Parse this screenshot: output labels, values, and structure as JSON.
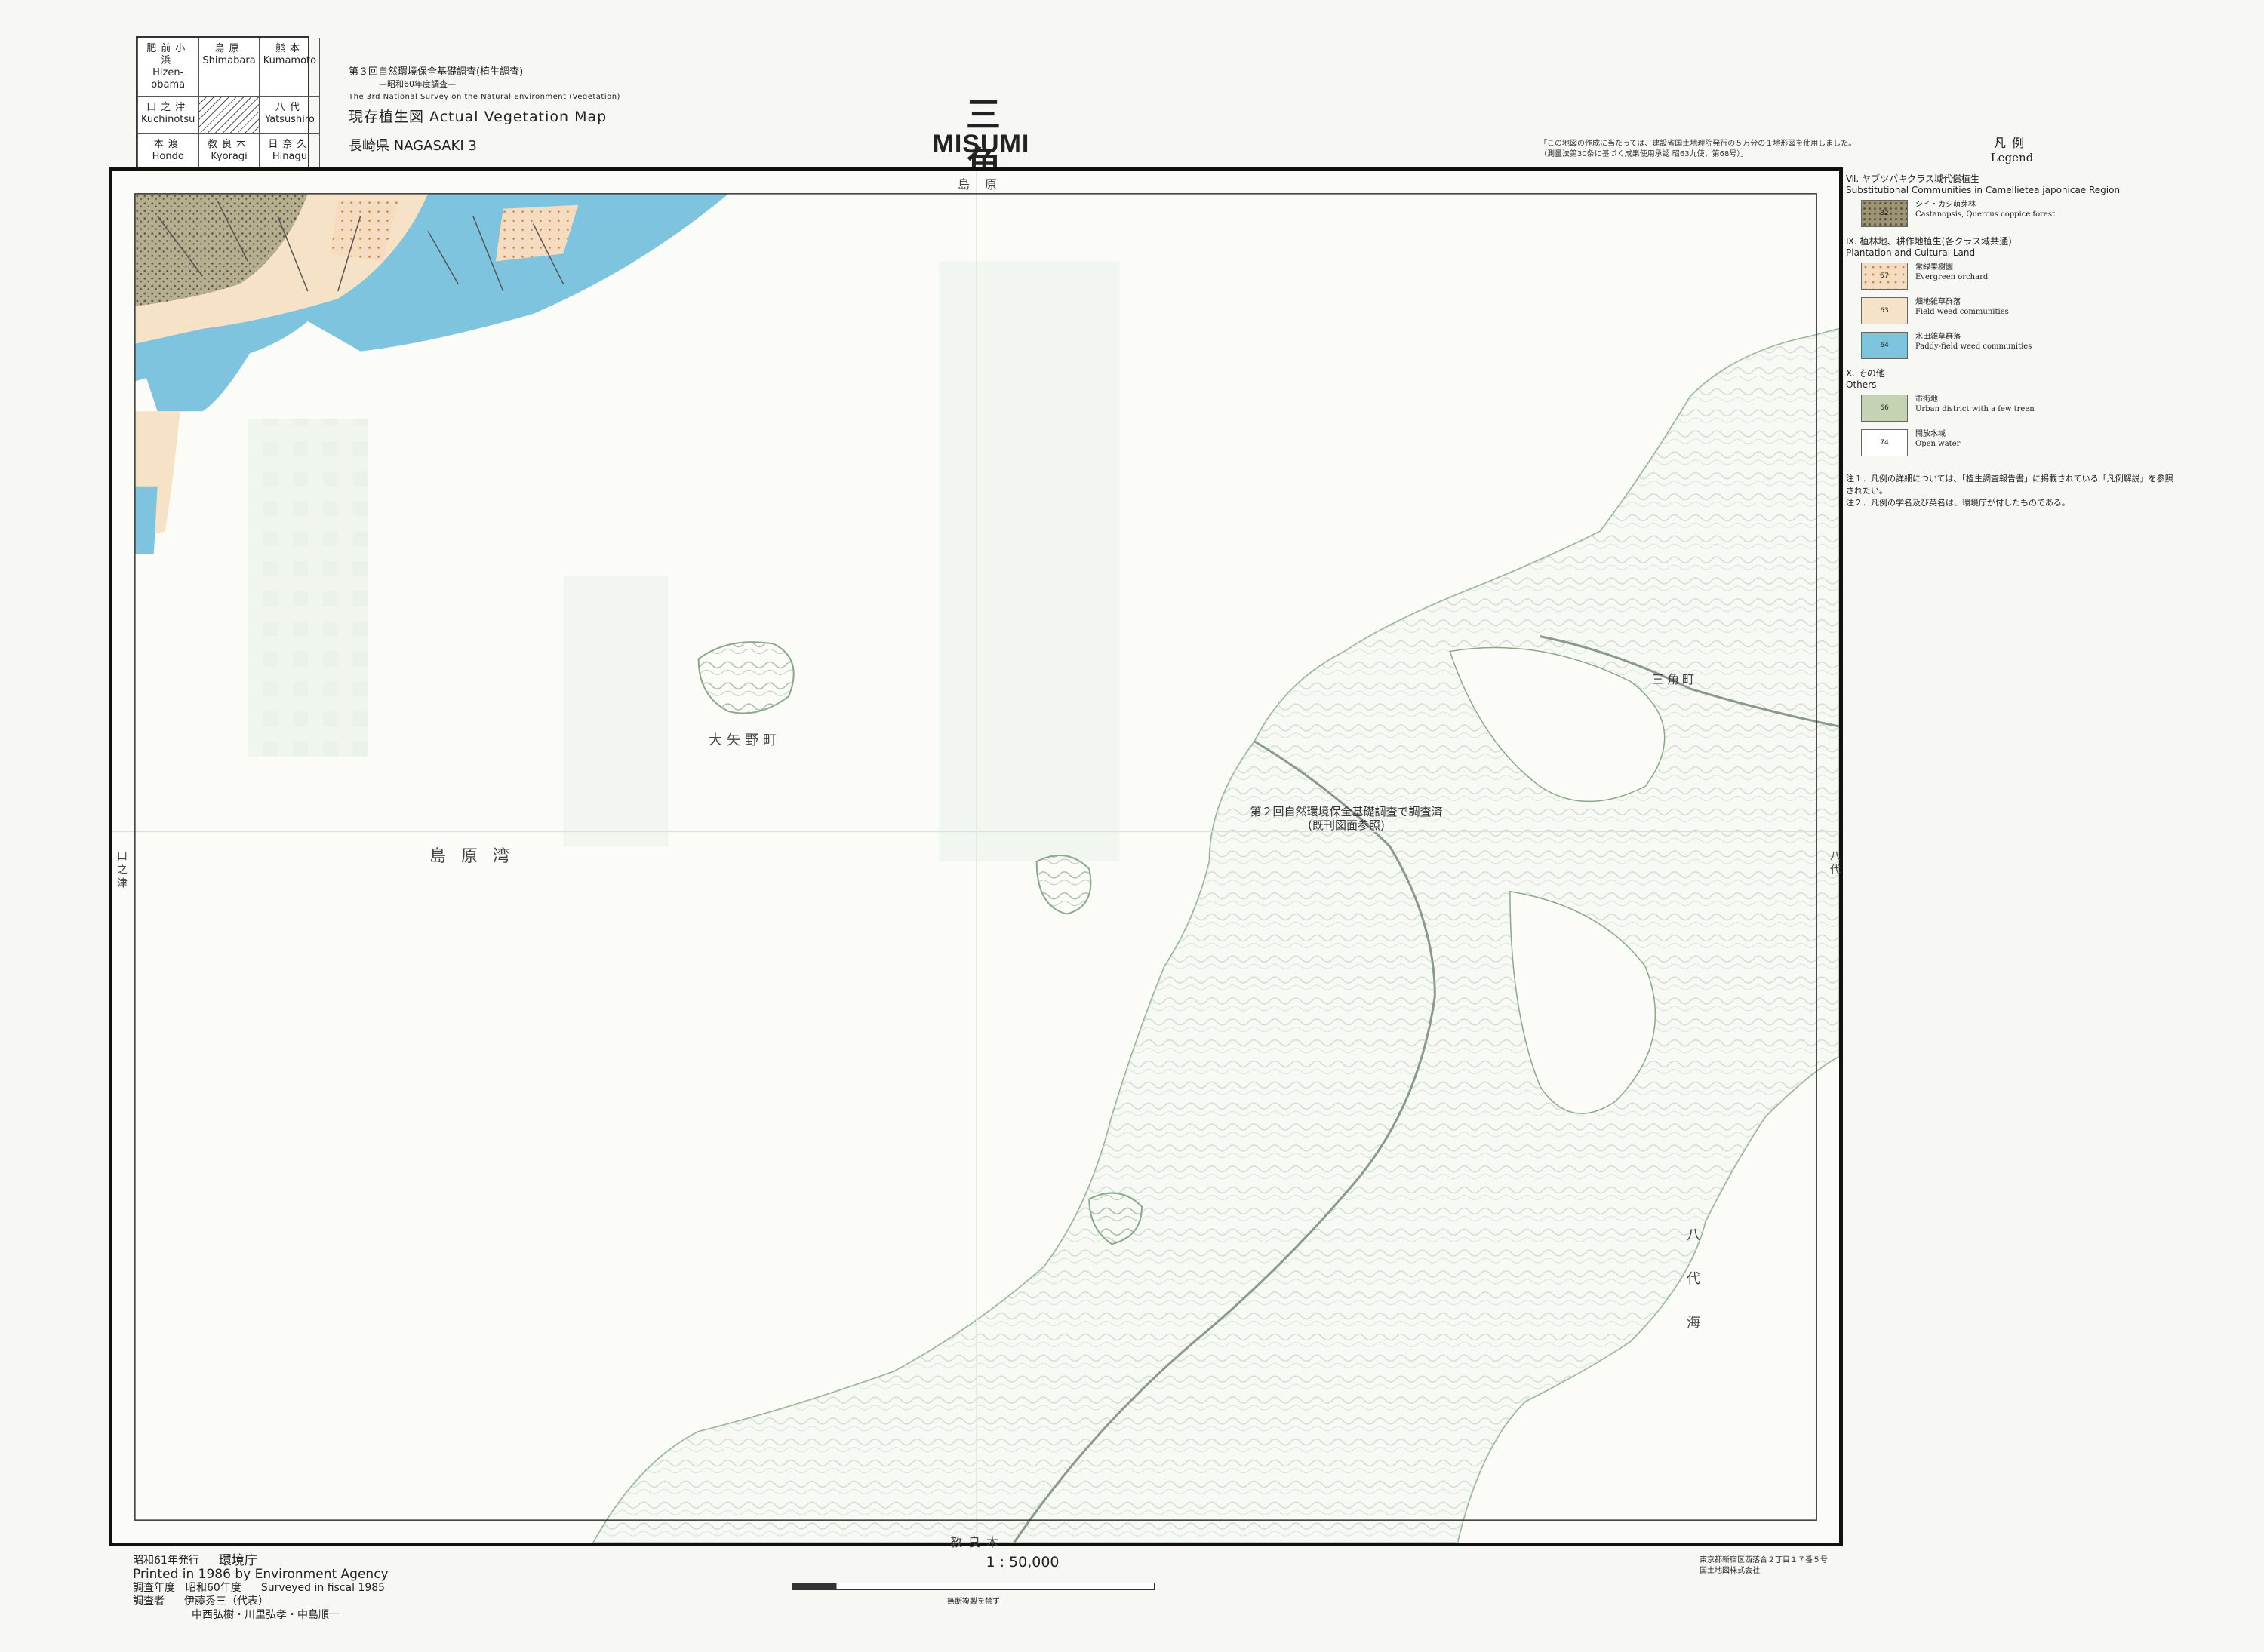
{
  "index_sheets": [
    {
      "jp": "肥前小浜",
      "en": "Hizen-obama"
    },
    {
      "jp": "島原",
      "en": "Shimabara"
    },
    {
      "jp": "熊本",
      "en": "Kumamoto"
    },
    {
      "jp": "口之津",
      "en": "Kuchinotsu"
    },
    {
      "jp": "",
      "en": ""
    },
    {
      "jp": "八代",
      "en": "Yatsushiro"
    },
    {
      "jp": "本渡",
      "en": "Hondo"
    },
    {
      "jp": "教良木",
      "en": "Kyoragi"
    },
    {
      "jp": "日奈久",
      "en": "Hinagu"
    }
  ],
  "survey": {
    "line1": "第３回自然環境保全基礎調査(植生調査)",
    "line2": "—昭和60年度調査—",
    "line3": "The 3rd National Survey on the Natural Environment (Vegetation)",
    "line4": "現存植生図 Actual Vegetation Map",
    "line5": "長崎県 NAGASAKI 3"
  },
  "title": {
    "jp": "三角",
    "en": "MISUMI"
  },
  "top_note": "「この地図の作成に当たっては、建設省国土地理院発行の５万分の１地形図を使用しました。（測量法第30条に基づく成果使用承認 昭63九使、第68号）」",
  "legend": {
    "title_jp": "凡例",
    "title_en": "Legend",
    "sections": [
      {
        "jp": "Ⅶ. ヤブツバキクラス域代償植生",
        "en": "Substitutional Communities in Camellietea japonicae Region",
        "items": [
          {
            "code": "32",
            "jp": "シイ・カシ萌芽林",
            "en": "Castanopsis, Quercus coppice forest",
            "color": "#9b9374",
            "pattern": "dots-dark"
          }
        ]
      },
      {
        "jp": "Ⅸ. 植林地、耕作地植生(各クラス域共通)",
        "en": "Plantation and Cultural Land",
        "items": [
          {
            "code": "57",
            "jp": "常緑果樹園",
            "en": "Evergreen orchard",
            "color": "#f5dcc0",
            "pattern": "dots"
          },
          {
            "code": "63",
            "jp": "畑地雑草群落",
            "en": "Field weed communities",
            "color": "#f6e2c6",
            "pattern": "plain"
          },
          {
            "code": "64",
            "jp": "水田雑草群落",
            "en": "Paddy-field weed communities",
            "color": "#7fc4df",
            "pattern": "plain"
          }
        ]
      },
      {
        "jp": "Ⅹ. その他",
        "en": "Others",
        "items": [
          {
            "code": "66",
            "jp": "市街地",
            "en": "Urban district with a few treen",
            "color": "#c5d2b4",
            "pattern": "plain"
          },
          {
            "code": "74",
            "jp": "開放水域",
            "en": "Open water",
            "color": "#ffffff",
            "pattern": "plain"
          }
        ]
      }
    ],
    "notes": [
      "注１．凡例の詳細については、「植生調査報告書」に掲載されている「凡例解説」を参照されたい。",
      "注２．凡例の学名及び英名は、環境庁が付したものである。"
    ]
  },
  "map": {
    "labels": {
      "top": "島原",
      "bay": "島原湾",
      "left_margin": "口之津",
      "right_margin": "八代",
      "bottom": "教良木",
      "island": "大矢野町",
      "town": "三角町",
      "yatsushiro_sea": "八代海"
    },
    "center_note": "第２回自然環境保全基礎調査で調査済\n(既刊図面参照)"
  },
  "footer": {
    "issued_jp": "昭和61年発行",
    "agency_jp": "環境庁",
    "printed_en": "Printed in 1986 by Environment Agency",
    "surveyed_jp": "調査年度　昭和60年度",
    "surveyed_en": "Surveyed in fiscal 1985",
    "surveyors_label": "調査者",
    "surveyors_1": "伊藤秀三（代表）",
    "surveyors_2": "中西弘樹・川里弘孝・中島順一",
    "scale": "1 : 50,000",
    "scale_warn": "無断複製を禁ず",
    "printer_1": "東京都新宿区西落合２丁目１７番５号",
    "printer_2": "国土地図株式会社"
  },
  "colors": {
    "paddy": "#7fc4df",
    "field": "#f6e2c6",
    "coppice": "#9b9374",
    "orchard_dot": "#c48a4a",
    "urban": "#c5d2b4",
    "contour": "#9fb59f",
    "faded_sea": "#e8f1e6"
  }
}
